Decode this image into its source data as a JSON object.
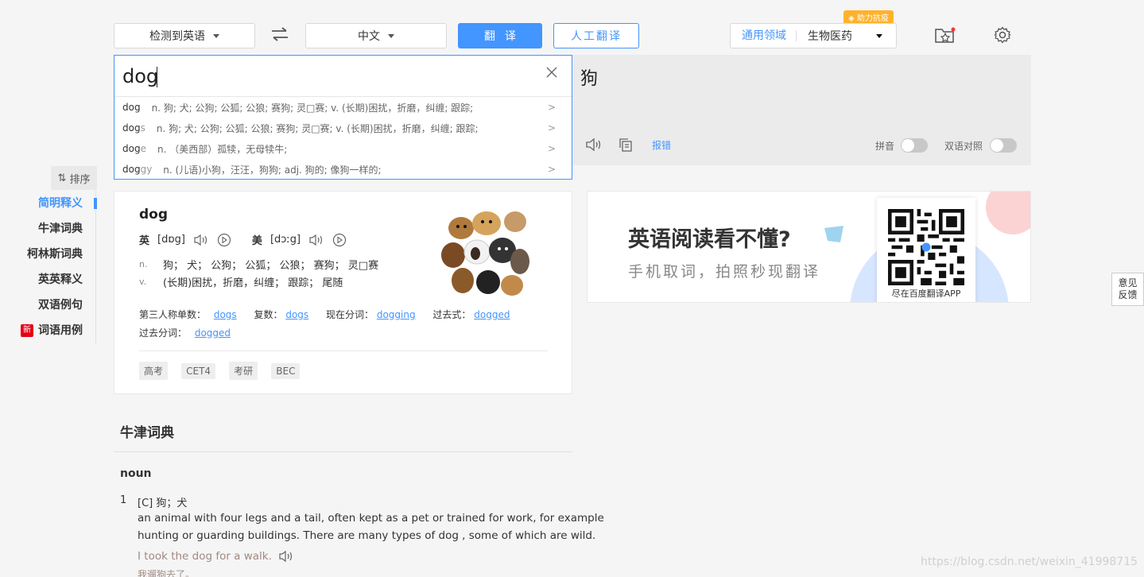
{
  "toolbar": {
    "source_lang": "检测到英语",
    "target_lang": "中文",
    "translate_label": "翻译",
    "human_translate_label": "人工翻译",
    "domain_prefix": "通用领域",
    "domain_value": "生物医药",
    "badge": "助力抗疫"
  },
  "input": {
    "value": "dog"
  },
  "suggestions": [
    {
      "bold": "dog",
      "grey": "",
      "def": "n. 狗; 犬; 公狗; 公狐; 公狼; 赛狗; 灵□赛; v. (长期)困扰，折磨，纠缠; 跟踪;"
    },
    {
      "bold": "dog",
      "grey": "s",
      "def": "n. 狗; 犬; 公狗; 公狐; 公狼; 赛狗; 灵□赛; v. (长期)困扰，折磨，纠缠; 跟踪;"
    },
    {
      "bold": "dog",
      "grey": "e",
      "def": "n. （美西部）孤犊，无母犊牛;"
    },
    {
      "bold": "dog",
      "grey": "gy",
      "def": "n. (儿语)小狗，汪汪，狗狗; adj. 狗的; 像狗一样的;"
    }
  ],
  "result": {
    "text": "狗",
    "report": "报错",
    "pinyin": "拼音",
    "bilingual": "双语对照"
  },
  "sidebar": {
    "sort": "排序",
    "items": [
      {
        "label": "简明释义",
        "active": true
      },
      {
        "label": "牛津词典"
      },
      {
        "label": "柯林斯词典"
      },
      {
        "label": "英英释义"
      },
      {
        "label": "双语例句"
      },
      {
        "label": "词语用例",
        "badge": "新"
      }
    ]
  },
  "dict": {
    "word": "dog",
    "uk_label": "英",
    "uk_phon": "[dɒg]",
    "us_label": "美",
    "us_phon": "[dɔːg]",
    "defs": [
      {
        "pos": "n.",
        "text": "狗；  犬；  公狗；  公狐；  公狼；  赛狗；  灵□赛"
      },
      {
        "pos": "v.",
        "text": "(长期)困扰，折磨，纠缠；  跟踪；  尾随"
      }
    ],
    "forms": [
      {
        "label": "第三人称单数：",
        "value": "dogs"
      },
      {
        "label": "复数：",
        "value": "dogs"
      },
      {
        "label": "现在分词：",
        "value": "dogging"
      },
      {
        "label": "过去式：",
        "value": "dogged"
      },
      {
        "label": "过去分词：",
        "value": "dogged"
      }
    ],
    "tags": [
      "高考",
      "CET4",
      "考研",
      "BEC"
    ]
  },
  "ad": {
    "headline": "英语阅读看不懂?",
    "sub": "手机取词，拍照秒现翻译",
    "qr_caption": "尽在百度翻译APP"
  },
  "oxford": {
    "title": "牛津词典",
    "pos": "noun",
    "num": "1",
    "sense": "[C] 狗；犬",
    "def_line1": "an animal with four legs and a tail, often kept as a pet or trained for work, for example",
    "def_line2": "hunting or guarding buildings. There are many types of dog , some of which are wild.",
    "example": "I took the dog for a walk.",
    "example_cn": "我遛狗去了。"
  },
  "feedback": {
    "line1": "意见",
    "line2": "反馈"
  },
  "watermark": "https://blog.csdn.net/weixin_41998715",
  "colors": {
    "accent": "#4395ff",
    "badge": "#ffb22a",
    "new_badge": "#e60012"
  }
}
